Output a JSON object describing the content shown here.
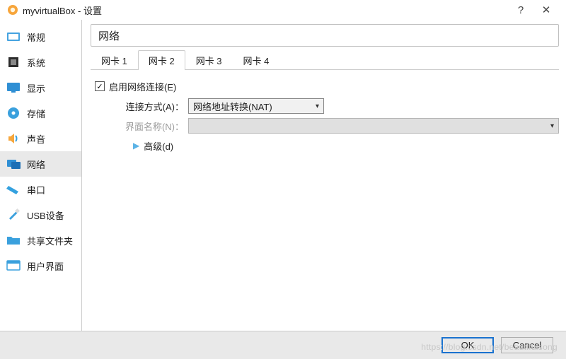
{
  "title": "myvirtualBox - 设置",
  "titlebar": {
    "help_glyph": "?",
    "close_glyph": "✕"
  },
  "sidebar": {
    "items": [
      {
        "label": "常规"
      },
      {
        "label": "系统"
      },
      {
        "label": "显示"
      },
      {
        "label": "存储"
      },
      {
        "label": "声音"
      },
      {
        "label": "网络"
      },
      {
        "label": "串口"
      },
      {
        "label": "USB设备"
      },
      {
        "label": "共享文件夹"
      },
      {
        "label": "用户界面"
      }
    ],
    "active_index": 5
  },
  "panel": {
    "title": "网络"
  },
  "tabs": {
    "items": [
      {
        "label": "网卡 1"
      },
      {
        "label": "网卡 2"
      },
      {
        "label": "网卡 3"
      },
      {
        "label": "网卡 4"
      }
    ],
    "active_index": 1
  },
  "form": {
    "enable_label": "启用网络连接(E)",
    "enable_checked": true,
    "attach_label": "连接方式(A)：",
    "attach_value": "网络地址转换(NAT)",
    "name_label": "界面名称(N)：",
    "name_value": "",
    "advanced_label": "高级(d)"
  },
  "footer": {
    "ok": "OK",
    "cancel": "Cancel"
  },
  "watermark": "https://blog.csdn.net/beautifulsong"
}
